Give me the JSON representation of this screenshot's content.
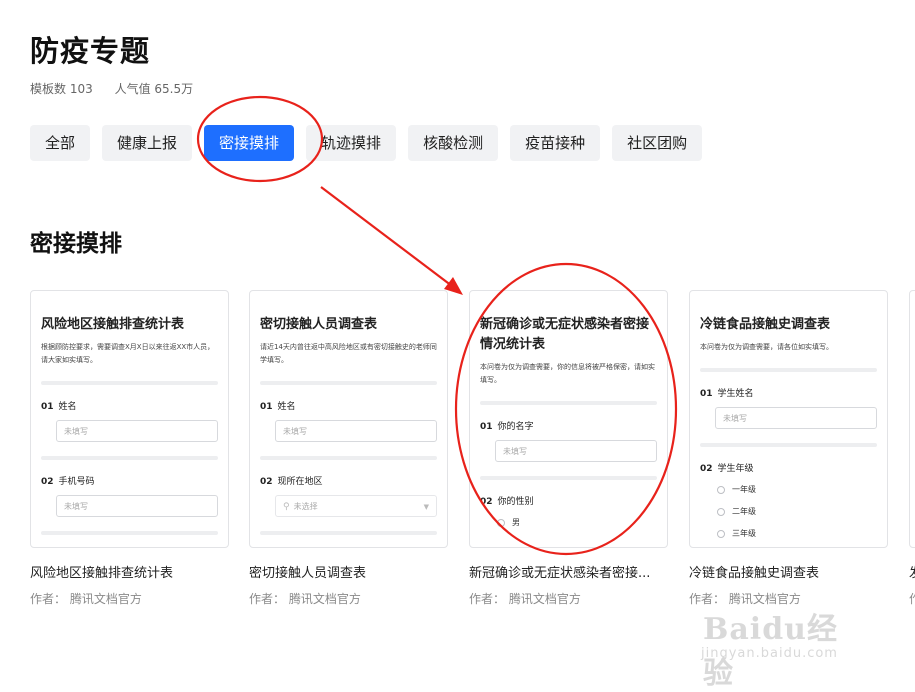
{
  "page": {
    "title": "防疫专题",
    "template_count": "模板数 103",
    "popularity": "人气值 65.5万"
  },
  "tabs": [
    {
      "label": "全部",
      "active": false
    },
    {
      "label": "健康上报",
      "active": false
    },
    {
      "label": "密接摸排",
      "active": true
    },
    {
      "label": "轨迹摸排",
      "active": false
    },
    {
      "label": "核酸检测",
      "active": false
    },
    {
      "label": "疫苗接种",
      "active": false
    },
    {
      "label": "社区团购",
      "active": false
    }
  ],
  "section": {
    "title": "密接摸排"
  },
  "cards": [
    {
      "preview_title": "风险地区接触排查统计表",
      "preview_desc": "根据顾防控要求，需要调查X月X日以来往返XX市人员，请大家如实填写。",
      "q1_num": "01",
      "q1_label": "姓名",
      "q1_placeholder": "未填写",
      "q2_num": "02",
      "q2_label": "手机号码",
      "q2_placeholder": "未填写",
      "name": "风险地区接触排查统计表",
      "author": "作者：  腾讯文档官方"
    },
    {
      "preview_title": "密切接触人员调查表",
      "preview_desc": "请近14天内曾往返中高风险地区或有密切接触史的老师同学填写。",
      "q1_num": "01",
      "q1_label": "姓名",
      "q1_placeholder": "未填写",
      "q2_num": "02",
      "q2_label": "现所在地区",
      "q2_placeholder": "未选择",
      "name": "密切接触人员调查表",
      "author": "作者：  腾讯文档官方"
    },
    {
      "preview_title": "新冠确诊或无症状感染者密接情况统计表",
      "preview_desc": "本问卷为仅为调查需要，你的信息将被严格保密，请如实填写。",
      "q1_num": "01",
      "q1_label": "你的名字",
      "q1_placeholder": "未填写",
      "q2_num": "02",
      "q2_label": "你的性别",
      "q2_option": "男",
      "name": "新冠确诊或无症状感染者密接...",
      "author": "作者：  腾讯文档官方"
    },
    {
      "preview_title": "冷链食品接触史调查表",
      "preview_desc": "本问卷为仅为调查需要，请各位如实填写。",
      "q1_num": "01",
      "q1_label": "学生姓名",
      "q1_placeholder": "未填写",
      "q2_num": "02",
      "q2_label": "学生年级",
      "q2_options": [
        "一年级",
        "二年级",
        "三年级"
      ],
      "name": "冷链食品接触史调查表",
      "author": "作者：  腾讯文档官方"
    },
    {
      "name": "发",
      "author": "作"
    }
  ],
  "annotation": {
    "color": "#e8221b"
  },
  "watermark": {
    "main": "Baidu经验",
    "sub": "jingyan.baidu.com"
  },
  "colors": {
    "accent": "#1e6fff",
    "tab_bg": "#f1f2f4"
  }
}
